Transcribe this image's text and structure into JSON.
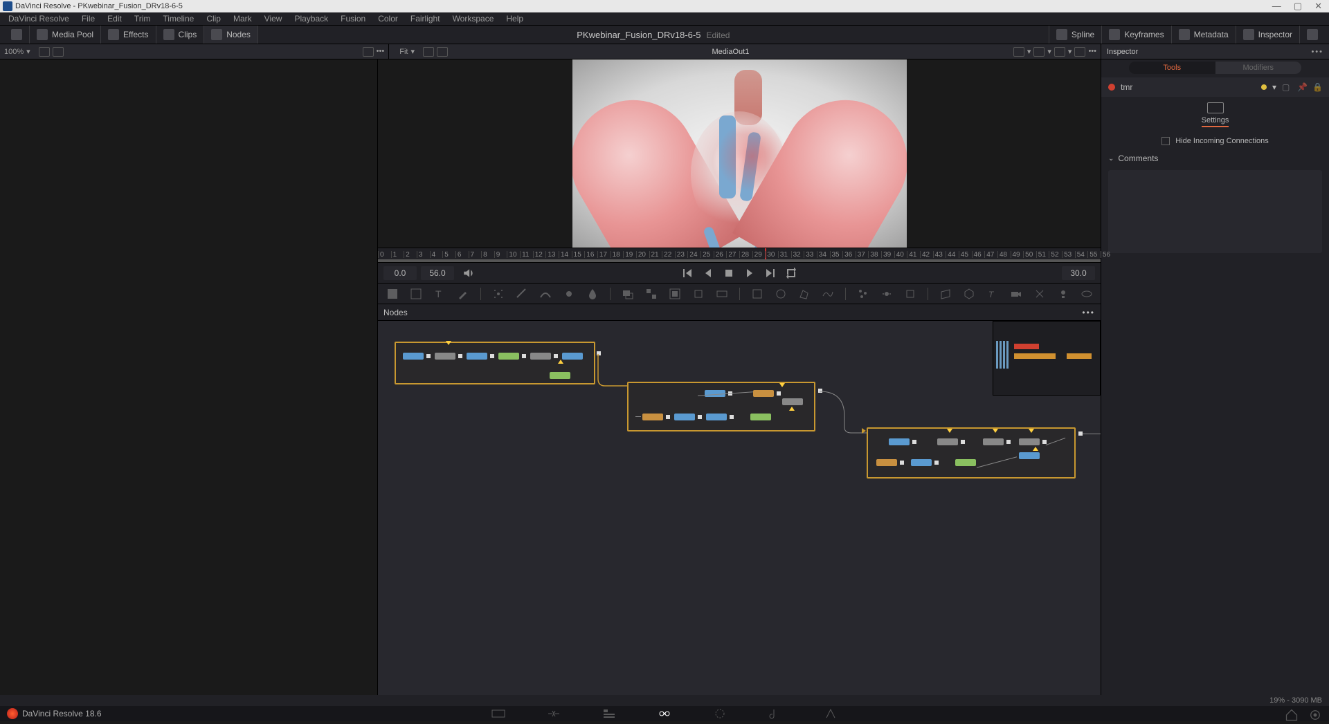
{
  "window": {
    "title": "DaVinci Resolve - PKwebinar_Fusion_DRv18-6-5"
  },
  "menu": [
    "DaVinci Resolve",
    "File",
    "Edit",
    "Trim",
    "Timeline",
    "Clip",
    "Mark",
    "View",
    "Playback",
    "Fusion",
    "Color",
    "Fairlight",
    "Workspace",
    "Help"
  ],
  "toolbar": {
    "mediapool": "Media Pool",
    "effects": "Effects",
    "clips": "Clips",
    "nodes": "Nodes",
    "project": "PKwebinar_Fusion_DRv18-6-5",
    "edited": "Edited",
    "spline": "Spline",
    "keyframes": "Keyframes",
    "metadata": "Metadata",
    "inspector": "Inspector"
  },
  "secbar": {
    "zoom": "100%",
    "fit": "Fit",
    "mediaout": "MediaOut1"
  },
  "timeline": {
    "ticks": [
      0,
      1,
      2,
      3,
      4,
      5,
      6,
      7,
      8,
      9,
      10,
      11,
      12,
      13,
      14,
      15,
      16,
      17,
      18,
      19,
      20,
      21,
      22,
      23,
      24,
      25,
      26,
      27,
      28,
      29,
      30,
      31,
      32,
      33,
      34,
      35,
      36,
      37,
      38,
      39,
      40,
      41,
      42,
      43,
      44,
      45,
      46,
      47,
      48,
      49,
      50,
      51,
      52,
      53,
      54,
      55,
      56
    ],
    "playhead": 30
  },
  "transport": {
    "start": "0.0",
    "end": "56.0",
    "current": "30.0"
  },
  "nodespanel": {
    "title": "Nodes"
  },
  "inspector": {
    "title": "Inspector",
    "tabs": {
      "tools": "Tools",
      "modifiers": "Modifiers"
    },
    "node": "tmr",
    "settings": "Settings",
    "hide": "Hide Incoming Connections",
    "comments": "Comments"
  },
  "status": {
    "text": "19% - 3090 MB"
  },
  "footer": {
    "version": "DaVinci Resolve 18.6"
  }
}
